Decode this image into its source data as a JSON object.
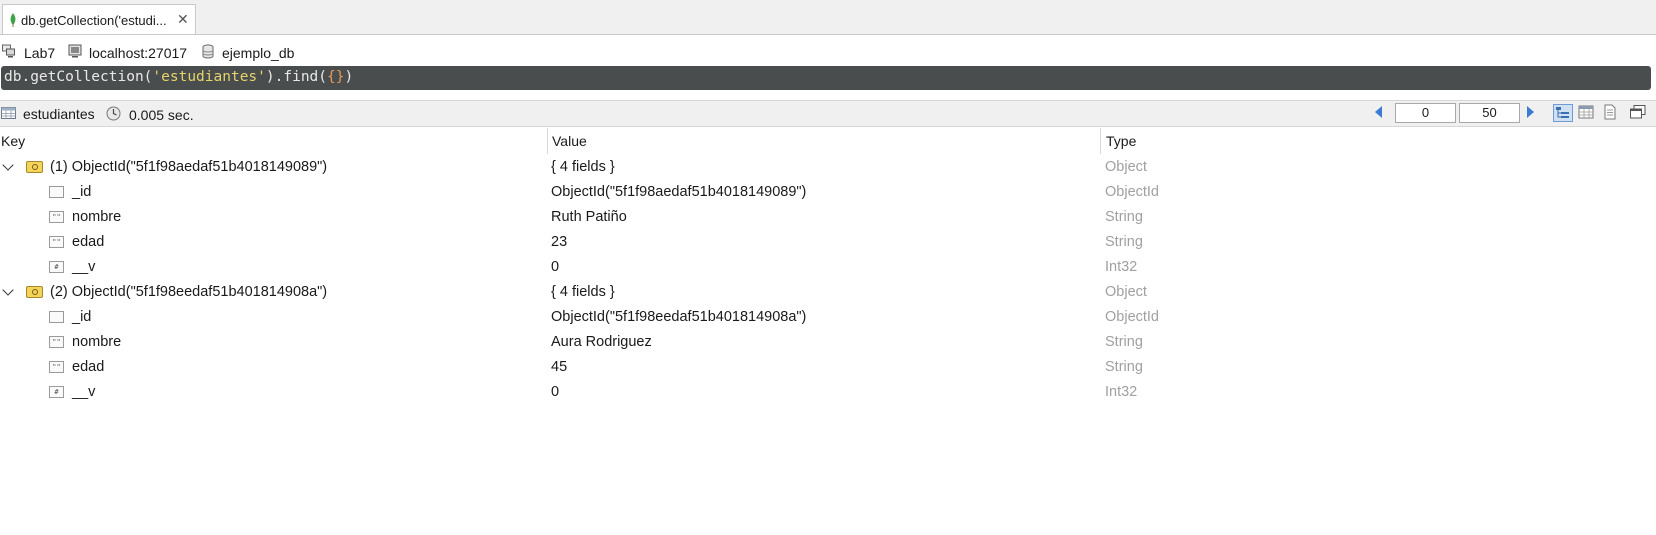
{
  "tab": {
    "title": "db.getCollection('estudi...",
    "close": "✕"
  },
  "info": {
    "connection": "Lab7",
    "server": "localhost:27017",
    "database": "ejemplo_db"
  },
  "query": {
    "prefix": "db.getCollection(",
    "arg": "'estudiantes'",
    "mid": ").find(",
    "brace": "{}",
    "suffix": ")"
  },
  "results": {
    "collection": "estudiantes",
    "time": "0.005 sec.",
    "skip": "0",
    "limit": "50"
  },
  "columns": {
    "key": "Key",
    "value": "Value",
    "type": "Type"
  },
  "rows": [
    {
      "key": "(1) ObjectId(\"5f1f98aedaf51b4018149089\")",
      "value": "{ 4 fields }",
      "type": "Object"
    },
    {
      "key": "_id",
      "value": "ObjectId(\"5f1f98aedaf51b4018149089\")",
      "type": "ObjectId"
    },
    {
      "key": "nombre",
      "value": "Ruth Patiño",
      "type": "String"
    },
    {
      "key": "edad",
      "value": "23",
      "type": "String"
    },
    {
      "key": "__v",
      "value": "0",
      "type": "Int32"
    },
    {
      "key": "(2) ObjectId(\"5f1f98eedaf51b401814908a\")",
      "value": "{ 4 fields }",
      "type": "Object"
    },
    {
      "key": "_id",
      "value": "ObjectId(\"5f1f98eedaf51b401814908a\")",
      "type": "ObjectId"
    },
    {
      "key": "nombre",
      "value": "Aura Rodriguez",
      "type": "String"
    },
    {
      "key": "edad",
      "value": "45",
      "type": "String"
    },
    {
      "key": "__v",
      "value": "0",
      "type": "Int32"
    }
  ],
  "icons": {
    "tab": "mongodb-leaf-icon",
    "connection": "computers-icon",
    "server": "server-icon",
    "database": "database-icon",
    "collection": "table-icon",
    "time": "clock-icon",
    "document": "document-icon",
    "field_id": "field-icon",
    "field_string": "string-icon",
    "field_number": "number-icon"
  },
  "colors": {
    "query_bg": "#4a4d4e",
    "string": "#e6d36a",
    "bracket": "#e39b5a",
    "type_text": "#a0a0a0",
    "accent": "#3a7bd5"
  }
}
